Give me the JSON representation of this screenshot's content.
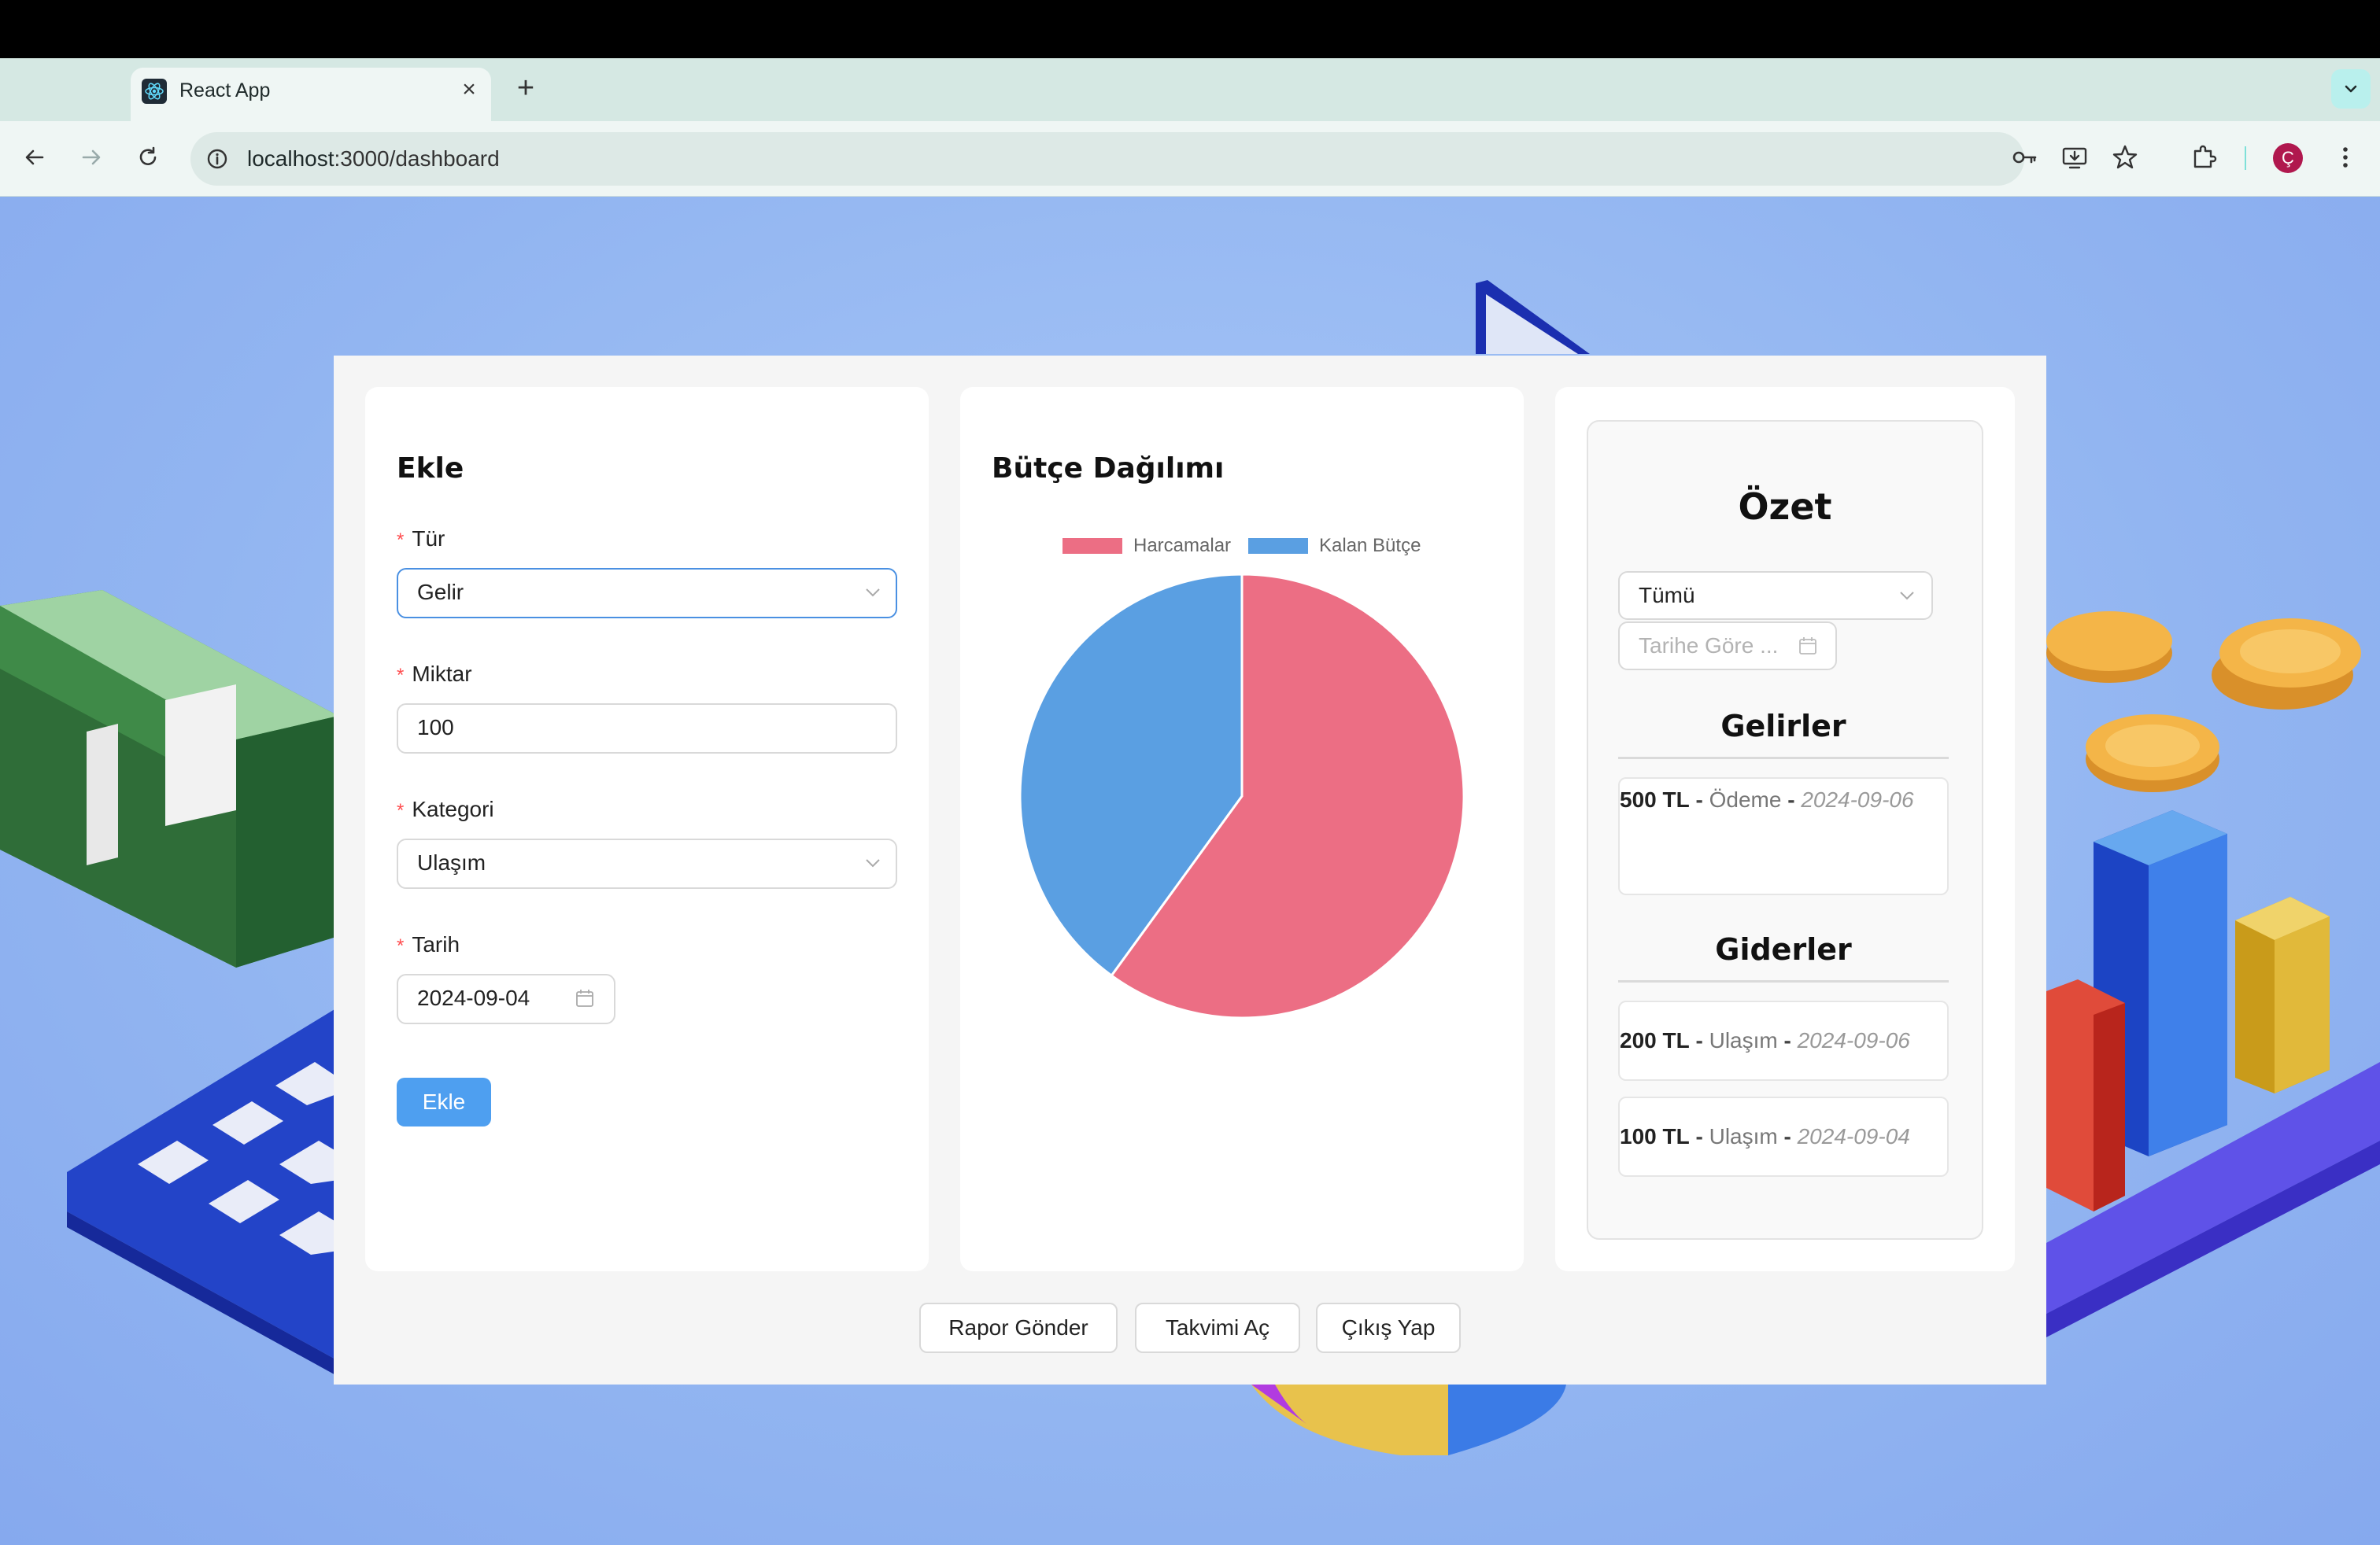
{
  "browser": {
    "tab_title": "React App",
    "url_host": "localhost",
    "url_path": ":3000/dashboard",
    "profile_initial": "Ç",
    "accent": "#b0184e"
  },
  "add_form": {
    "title": "Ekle",
    "type_label": "Tür",
    "type_value": "Gelir",
    "amount_label": "Miktar",
    "amount_value": "100",
    "category_label": "Kategori",
    "category_value": "Ulaşım",
    "date_label": "Tarih",
    "date_value": "2024-09-04",
    "submit_label": "Ekle",
    "required_mark": "*"
  },
  "budget": {
    "title": "Bütçe Dağılımı"
  },
  "chart_data": {
    "type": "pie",
    "categories": [
      "Harcamalar",
      "Kalan Bütçe"
    ],
    "values": [
      300,
      200
    ],
    "colors": [
      "#ec6e84",
      "#5a9fe2"
    ],
    "legend": "top"
  },
  "summary": {
    "title": "Özet",
    "filter_value": "Tümü",
    "date_placeholder": "Tarihe Göre ...",
    "incomes_title": "Gelirler",
    "incomes": [
      {
        "amount": "500 TL",
        "category": "Ödeme",
        "date": "2024-09-06"
      }
    ],
    "expenses_title": "Giderler",
    "expenses": [
      {
        "amount": "200 TL",
        "category": "Ulaşım",
        "date": "2024-09-06"
      },
      {
        "amount": "100 TL",
        "category": "Ulaşım",
        "date": "2024-09-04"
      }
    ],
    "separator": "-"
  },
  "footer": {
    "report_label": "Rapor Gönder",
    "calendar_label": "Takvimi Aç",
    "logout_label": "Çıkış Yap"
  }
}
